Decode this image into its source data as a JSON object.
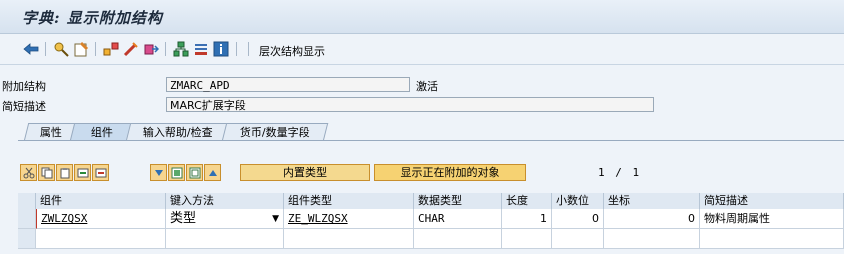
{
  "title": "字典: 显示附加结构",
  "toolbar": {
    "icons": [
      "back-icon",
      "other-object-icon",
      "display-change-icon",
      "hierarchy-icon",
      "activate-icon",
      "where-used-icon",
      "object-tree-icon",
      "standard-icon",
      "info-icon"
    ],
    "hierarchy_label": "层次结构显示"
  },
  "form": {
    "append_structure_label": "附加结构",
    "append_structure_value": "ZMARC_APD",
    "status": "激活",
    "short_desc_label": "简短描述",
    "short_desc_value": "MARC扩展字段"
  },
  "tabs": [
    "属性",
    "组件",
    "输入帮助/检查",
    "货币/数量字段"
  ],
  "active_tab": "组件",
  "buttons": {
    "builtin_type": "内置类型",
    "show_appended": "显示正在附加的对象"
  },
  "pager": {
    "current": "1",
    "separator": "/",
    "total": "1"
  },
  "table": {
    "columns": [
      "组件",
      "键入方法",
      "组件类型",
      "数据类型",
      "长度",
      "小数位",
      "坐标",
      "简短描述"
    ],
    "rows": [
      {
        "component": "ZWLZQSX",
        "typing_method": "类型",
        "component_type": "ZE_WLZQSX",
        "data_type": "CHAR",
        "length": "1",
        "decimals": "0",
        "coordinate": "0",
        "short_desc": "物料周期属性"
      }
    ]
  },
  "colors": {
    "accent_button": "#f6d58f",
    "button_border": "#c88f2d",
    "background": "#eef3f9"
  }
}
